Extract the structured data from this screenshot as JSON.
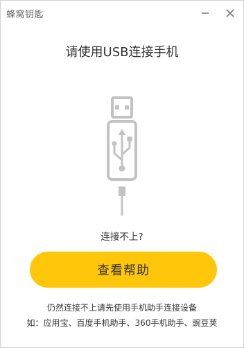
{
  "window": {
    "title": "蜂窝钥匙"
  },
  "main": {
    "headline": "请使用USB连接手机",
    "hint": "连接不上?",
    "help_button_label": "查看帮助",
    "footer_line_1": "仍然连接不上请先使用手机助手连接设备",
    "footer_line_2": "如：应用宝、百度手机助手、360手机助手、豌豆荚"
  },
  "icons": {
    "minimize": "minimize-icon",
    "close": "close-icon",
    "usb": "usb-connector-icon"
  },
  "colors": {
    "accent": "#ffc60a",
    "illustration": "#c2c2c2",
    "text": "#333333"
  }
}
